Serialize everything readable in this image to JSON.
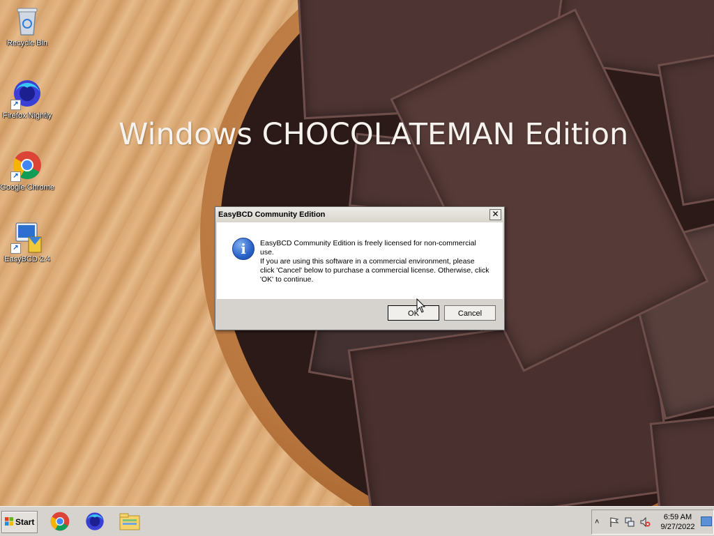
{
  "desktop": {
    "watermark": "Windows CHOCOLATEMAN Edition",
    "icons": [
      {
        "label": "Recycle Bin",
        "icon": "recycle-bin-icon"
      },
      {
        "label": "Firefox Nightly",
        "icon": "firefox-nightly-icon"
      },
      {
        "label": "Google Chrome",
        "icon": "chrome-icon"
      },
      {
        "label": "EasyBCD 2.4",
        "icon": "easybcd-icon"
      }
    ]
  },
  "dialog": {
    "title": "EasyBCD Community Edition",
    "close_label": "✕",
    "icon": "info-icon",
    "message_line1": "EasyBCD Community Edition is freely licensed for non-commercial use.",
    "message_line2": "If you are using this software in a commercial environment, please click 'Cancel' below to purchase a commercial license. Otherwise, click 'OK' to continue.",
    "ok_label": "OK",
    "cancel_label": "Cancel"
  },
  "taskbar": {
    "start_label": "Start",
    "pinned": [
      "chrome-icon",
      "firefox-nightly-icon",
      "file-explorer-icon"
    ],
    "tray": {
      "icons": [
        "show-hidden-icons-chevron",
        "action-center-flag-icon",
        "network-icon",
        "volume-muted-icon"
      ],
      "time": "6:59 AM",
      "date": "9/27/2022"
    }
  },
  "colors": {
    "dialog_bg": "#d6d3ce",
    "taskbar_bg": "#d6d3ce",
    "watermark_text": "#f6f2ee"
  }
}
